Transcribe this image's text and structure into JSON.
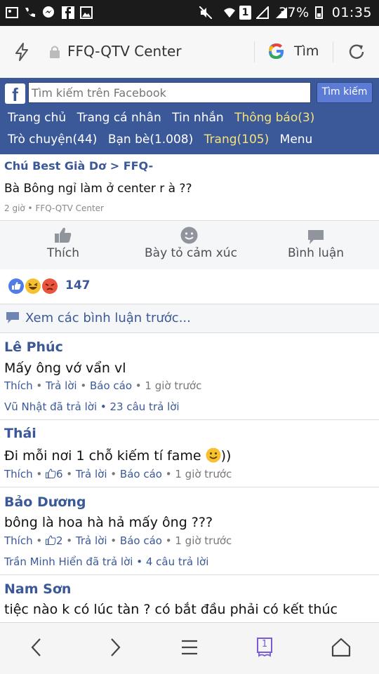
{
  "status_bar": {
    "battery": "37%",
    "time": "01:35",
    "sim_badge": "1"
  },
  "browser": {
    "page_title": "FFQ-QTV Center",
    "search_label": "Tìm"
  },
  "facebook": {
    "logo": "f",
    "search_placeholder": "Tìm kiếm trên Facebook",
    "search_button": "Tìm kiếm",
    "nav_row1": [
      "Trang chủ",
      "Trang cá nhân",
      "Tin nhắn",
      "Thông báo(3)"
    ],
    "nav_row2": [
      "Trò chuyện(44)",
      "Bạn bè(1.008)",
      "Trang(105)",
      "Menu"
    ]
  },
  "post": {
    "breadcrumb": "Chú Best Già Dơ > FFQ-",
    "text": "Bà Bông ngỉ làm ở center r à ??",
    "meta": "2 giờ • FFQ-QTV Center"
  },
  "actions": {
    "like": "Thích",
    "react": "Bày tỏ cảm xúc",
    "comment": "Bình luận"
  },
  "reactions": {
    "count": "147",
    "colors": {
      "like": "#4f7ce8",
      "haha": "#f7c02e",
      "angry": "#e9543d"
    }
  },
  "previous_comments": "Xem các bình luận trước...",
  "comments": [
    {
      "name": "Lê Phúc",
      "body": "Mấy ông vớ vẩn vl",
      "meta": {
        "like": "Thích",
        "likes": "",
        "reply": "Trả lời",
        "report": "Báo cáo",
        "time": "1 giờ trước"
      },
      "replies": "Vũ Nhật đã trả lời • 23 câu trả lời"
    },
    {
      "name": "Thái",
      "body": "Đi mỗi nơi 1 chỗ kiếm tí fame",
      "body_suffix": "))",
      "meta": {
        "like": "Thích",
        "likes": "6",
        "reply": "Trả lời",
        "report": "Báo cáo",
        "time": "1 giờ trước"
      },
      "replies": ""
    },
    {
      "name": "Bảo Dương",
      "body": "bông là hoa hà hả mấy ông ???",
      "meta": {
        "like": "Thích",
        "likes": "2",
        "reply": "Trả lời",
        "report": "Báo cáo",
        "time": "1 giờ trước"
      },
      "replies": "Trần Minh Hiển đã trả lời • 4 câu trả lời"
    },
    {
      "name": "Nam Sơn",
      "body": "tiệc nào k có lúc tàn ? có bắt đầu phải có kết thúc",
      "meta": {
        "like": "",
        "likes": "",
        "reply": "",
        "report": "",
        "time": ""
      },
      "replies": ""
    }
  ],
  "bottom_nav": {
    "tab_count": "1"
  }
}
